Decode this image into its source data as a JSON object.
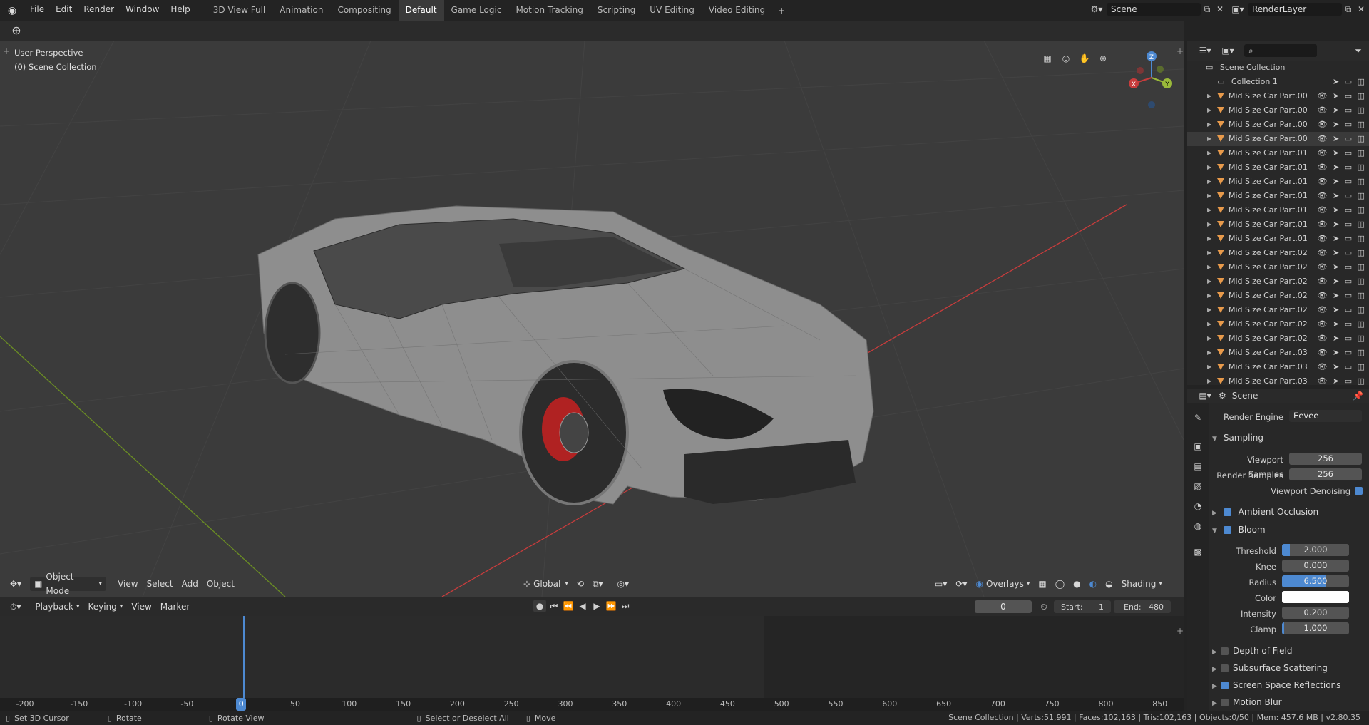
{
  "menu": [
    "File",
    "Edit",
    "Render",
    "Window",
    "Help"
  ],
  "workspace_tabs": [
    {
      "label": "3D View Full"
    },
    {
      "label": "Animation"
    },
    {
      "label": "Compositing"
    },
    {
      "label": "Default",
      "active": true
    },
    {
      "label": "Game Logic"
    },
    {
      "label": "Motion Tracking"
    },
    {
      "label": "Scripting"
    },
    {
      "label": "UV Editing"
    },
    {
      "label": "Video Editing"
    }
  ],
  "scene_field": "Scene",
  "render_layer_field": "RenderLayer",
  "viewport": {
    "view_name": "User Perspective",
    "collection_label": "(0) Scene Collection",
    "gizmo_axes": {
      "z": "Z",
      "x": "X",
      "y": "Y"
    }
  },
  "vp_header": {
    "mode": "Object Mode",
    "menus": [
      "View",
      "Select",
      "Add",
      "Object"
    ],
    "transform_orientation": "Global",
    "overlays_label": "Overlays",
    "shading_label": "Shading"
  },
  "timeline_header": {
    "menus": [
      "Playback",
      "Keying",
      "View",
      "Marker"
    ],
    "current_frame": "0",
    "start_label": "Start:",
    "start_value": "1",
    "end_label": "End:",
    "end_value": "480"
  },
  "timeline_ticks": [
    "-200",
    "-150",
    "-100",
    "-50",
    "0",
    "50",
    "100",
    "150",
    "200",
    "250",
    "300",
    "350",
    "400",
    "450",
    "500",
    "550",
    "600",
    "650",
    "700",
    "750",
    "800",
    "850"
  ],
  "status": {
    "items": [
      {
        "label": "Set 3D Cursor"
      },
      {
        "label": "Rotate"
      },
      {
        "label": "Rotate View"
      },
      {
        "label": "Select or Deselect All"
      },
      {
        "label": "Move"
      }
    ],
    "stats": "Scene Collection | Verts:51,991 | Faces:102,163 | Tris:102,163 | Objects:0/50 | Mem: 457.6 MB | v2.80.35"
  },
  "outliner": {
    "root": "Scene Collection",
    "collection": "Collection 1",
    "objects": [
      "Mid Size Car Part.00",
      "Mid Size Car Part.00",
      "Mid Size Car Part.00",
      "Mid Size Car Part.00",
      "Mid Size Car Part.01",
      "Mid Size Car Part.01",
      "Mid Size Car Part.01",
      "Mid Size Car Part.01",
      "Mid Size Car Part.01",
      "Mid Size Car Part.01",
      "Mid Size Car Part.01",
      "Mid Size Car Part.02",
      "Mid Size Car Part.02",
      "Mid Size Car Part.02",
      "Mid Size Car Part.02",
      "Mid Size Car Part.02",
      "Mid Size Car Part.02",
      "Mid Size Car Part.02",
      "Mid Size Car Part.03",
      "Mid Size Car Part.03",
      "Mid Size Car Part.03"
    ]
  },
  "properties": {
    "context": "Scene",
    "render_engine_label": "Render Engine",
    "render_engine": "Eevee",
    "sampling": {
      "title": "Sampling",
      "viewport_samples_label": "Viewport Samples",
      "viewport_samples": "256",
      "render_samples_label": "Render Samples",
      "render_samples": "256",
      "denoise_label": "Viewport Denoising"
    },
    "ambient_occlusion": "Ambient Occlusion",
    "bloom": {
      "title": "Bloom",
      "threshold_label": "Threshold",
      "threshold": "2.000",
      "threshold_fill": 0.12,
      "knee_label": "Knee",
      "knee": "0.000",
      "radius_label": "Radius",
      "radius": "6.500",
      "radius_fill": 0.65,
      "color_label": "Color",
      "intensity_label": "Intensity",
      "intensity": "0.200",
      "clamp_label": "Clamp",
      "clamp": "1.000",
      "clamp_fill": 0.03
    },
    "sections": [
      {
        "label": "Depth of Field",
        "checked": false
      },
      {
        "label": "Subsurface Scattering",
        "checked": false
      },
      {
        "label": "Screen Space Reflections",
        "checked": true
      },
      {
        "label": "Motion Blur",
        "checked": false
      }
    ]
  },
  "colors": {
    "accent": "#4d89d1",
    "object_icon": "#e89a4b",
    "x_axis": "#c83c3c",
    "y_axis": "#6b8e23",
    "viewport_bg": "#3b3b3b"
  }
}
